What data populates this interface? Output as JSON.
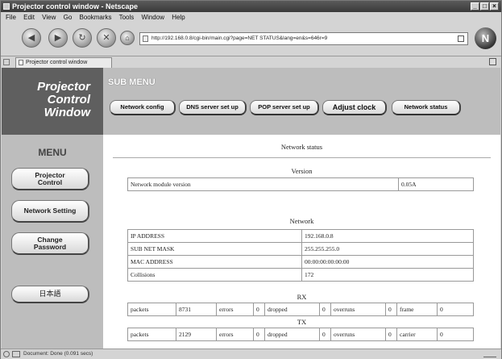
{
  "window": {
    "title": "Projector control window - Netscape"
  },
  "menubar": [
    "File",
    "Edit",
    "View",
    "Go",
    "Bookmarks",
    "Tools",
    "Window",
    "Help"
  ],
  "navbar": {
    "url": "http://192.168.0.8/cgi-bin/main.cgi?page=NET STATUS&lang=en&s=646r=9",
    "buttons": {
      "back": "back-icon",
      "forward": "forward-icon",
      "reload": "reload-icon",
      "stop": "stop-icon",
      "home": "home-icon"
    }
  },
  "tab": {
    "label": "Projector control window"
  },
  "sidebar": {
    "logo_lines": [
      "Projector",
      "Control",
      "Window"
    ],
    "menu_title": "MENU",
    "buttons": [
      {
        "label_lines": [
          "Projector",
          "Control"
        ]
      },
      {
        "label_lines": [
          "Network Setting"
        ]
      },
      {
        "label_lines": [
          "Change",
          "Password"
        ]
      },
      {
        "label_lines": [
          "日本語"
        ]
      }
    ]
  },
  "submenu": {
    "title": "SUB MENU",
    "buttons": [
      "Network config",
      "DNS server set up",
      "POP server set up",
      "Adjust clock",
      "Network status"
    ]
  },
  "content": {
    "title": "Network status",
    "version": {
      "section": "Version",
      "label": "Network module version",
      "value": "0.05A"
    },
    "network": {
      "section": "Network",
      "rows": [
        {
          "label": "IP ADDRESS",
          "value": "192.168.0.8"
        },
        {
          "label": "SUB NET MASK",
          "value": "255.255.255.0"
        },
        {
          "label": "MAC ADDRESS",
          "value": "00:00:00:00:00:00"
        },
        {
          "label": "Collisions",
          "value": "172"
        }
      ]
    },
    "rx": {
      "section": "RX",
      "cells": [
        {
          "label": "packets",
          "value": "8731"
        },
        {
          "label": "errors",
          "value": "0"
        },
        {
          "label": "dropped",
          "value": "0"
        },
        {
          "label": "overruns",
          "value": "0"
        },
        {
          "label": "frame",
          "value": "0"
        }
      ]
    },
    "tx": {
      "section": "TX",
      "cells": [
        {
          "label": "packets",
          "value": "2129"
        },
        {
          "label": "errors",
          "value": "0"
        },
        {
          "label": "dropped",
          "value": "0"
        },
        {
          "label": "overruns",
          "value": "0"
        },
        {
          "label": "carrier",
          "value": "0"
        }
      ]
    }
  },
  "statusbar": {
    "text": "Document: Done (0.091 secs)"
  }
}
